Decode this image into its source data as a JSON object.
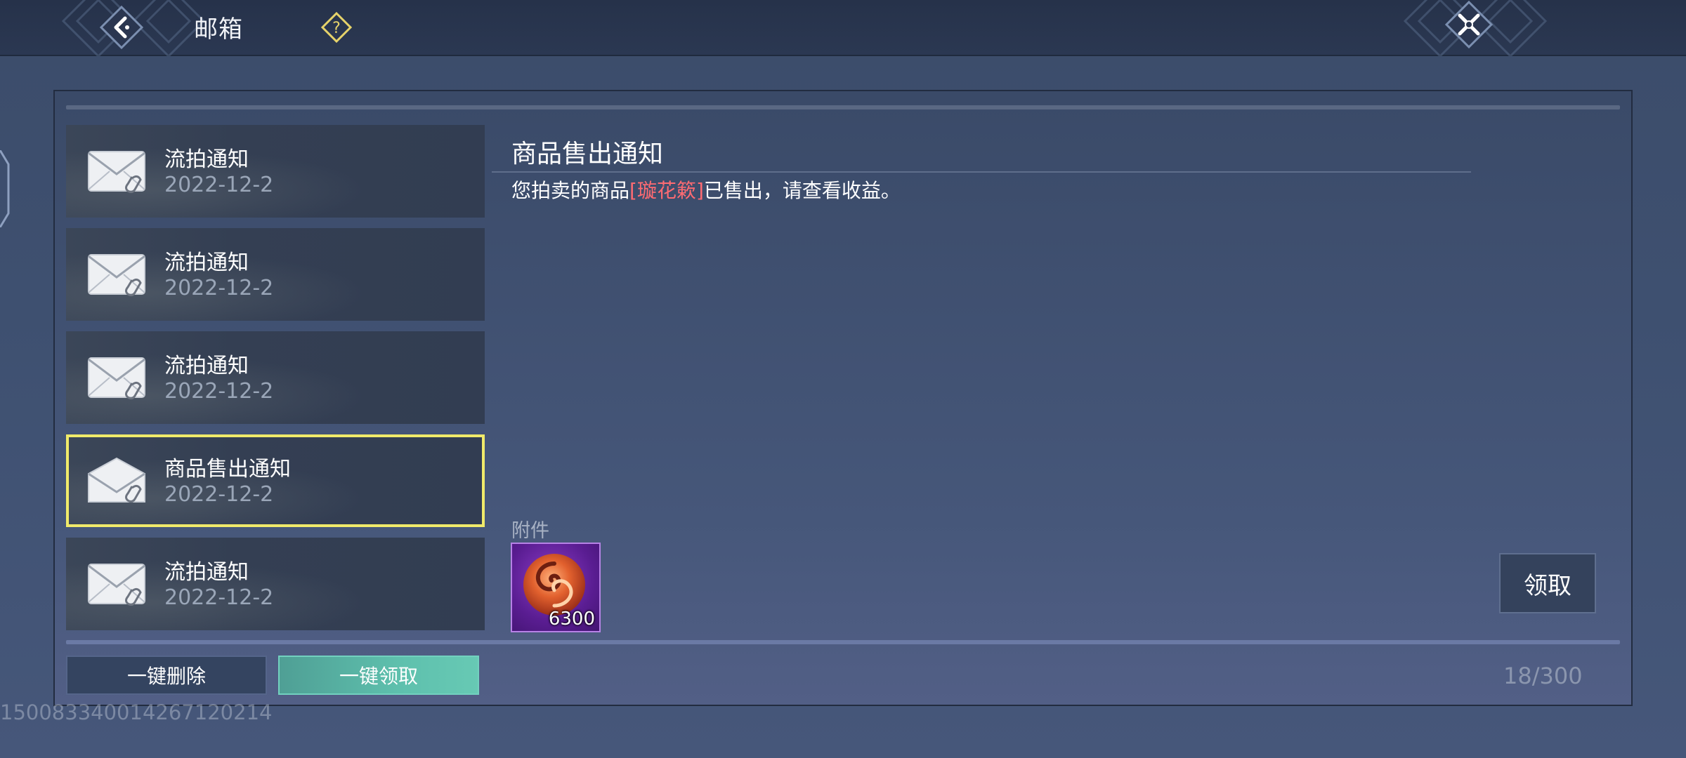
{
  "header": {
    "title": "邮箱",
    "back_icon": "chevron-left-icon",
    "help_icon": "question-icon",
    "close_icon": "close-x-icon"
  },
  "mail_list": [
    {
      "title": "流拍通知",
      "date": "2022-12-2",
      "selected": false
    },
    {
      "title": "流拍通知",
      "date": "2022-12-2",
      "selected": false
    },
    {
      "title": "流拍通知",
      "date": "2022-12-2",
      "selected": false
    },
    {
      "title": "商品售出通知",
      "date": "2022-12-2",
      "selected": true
    },
    {
      "title": "流拍通知",
      "date": "2022-12-2",
      "selected": false
    }
  ],
  "content": {
    "title": "商品售出通知",
    "body_prefix": "您拍卖的商品",
    "item_name": "[璇花簌]",
    "body_suffix": "已售出，请查看收益。"
  },
  "attachment": {
    "label": "附件",
    "count": "6300",
    "icon": "currency-swirl-icon"
  },
  "buttons": {
    "claim": "领取",
    "delete_all": "一键删除",
    "claim_all": "一键领取"
  },
  "mail_count": "18/300",
  "uid": "150083340014267120214",
  "colors": {
    "selected_border": "#f0ea6a",
    "item_highlight": "#ff6b72",
    "claim_all_bg": "#5ec0ad",
    "help_icon": "#e6d36a"
  }
}
